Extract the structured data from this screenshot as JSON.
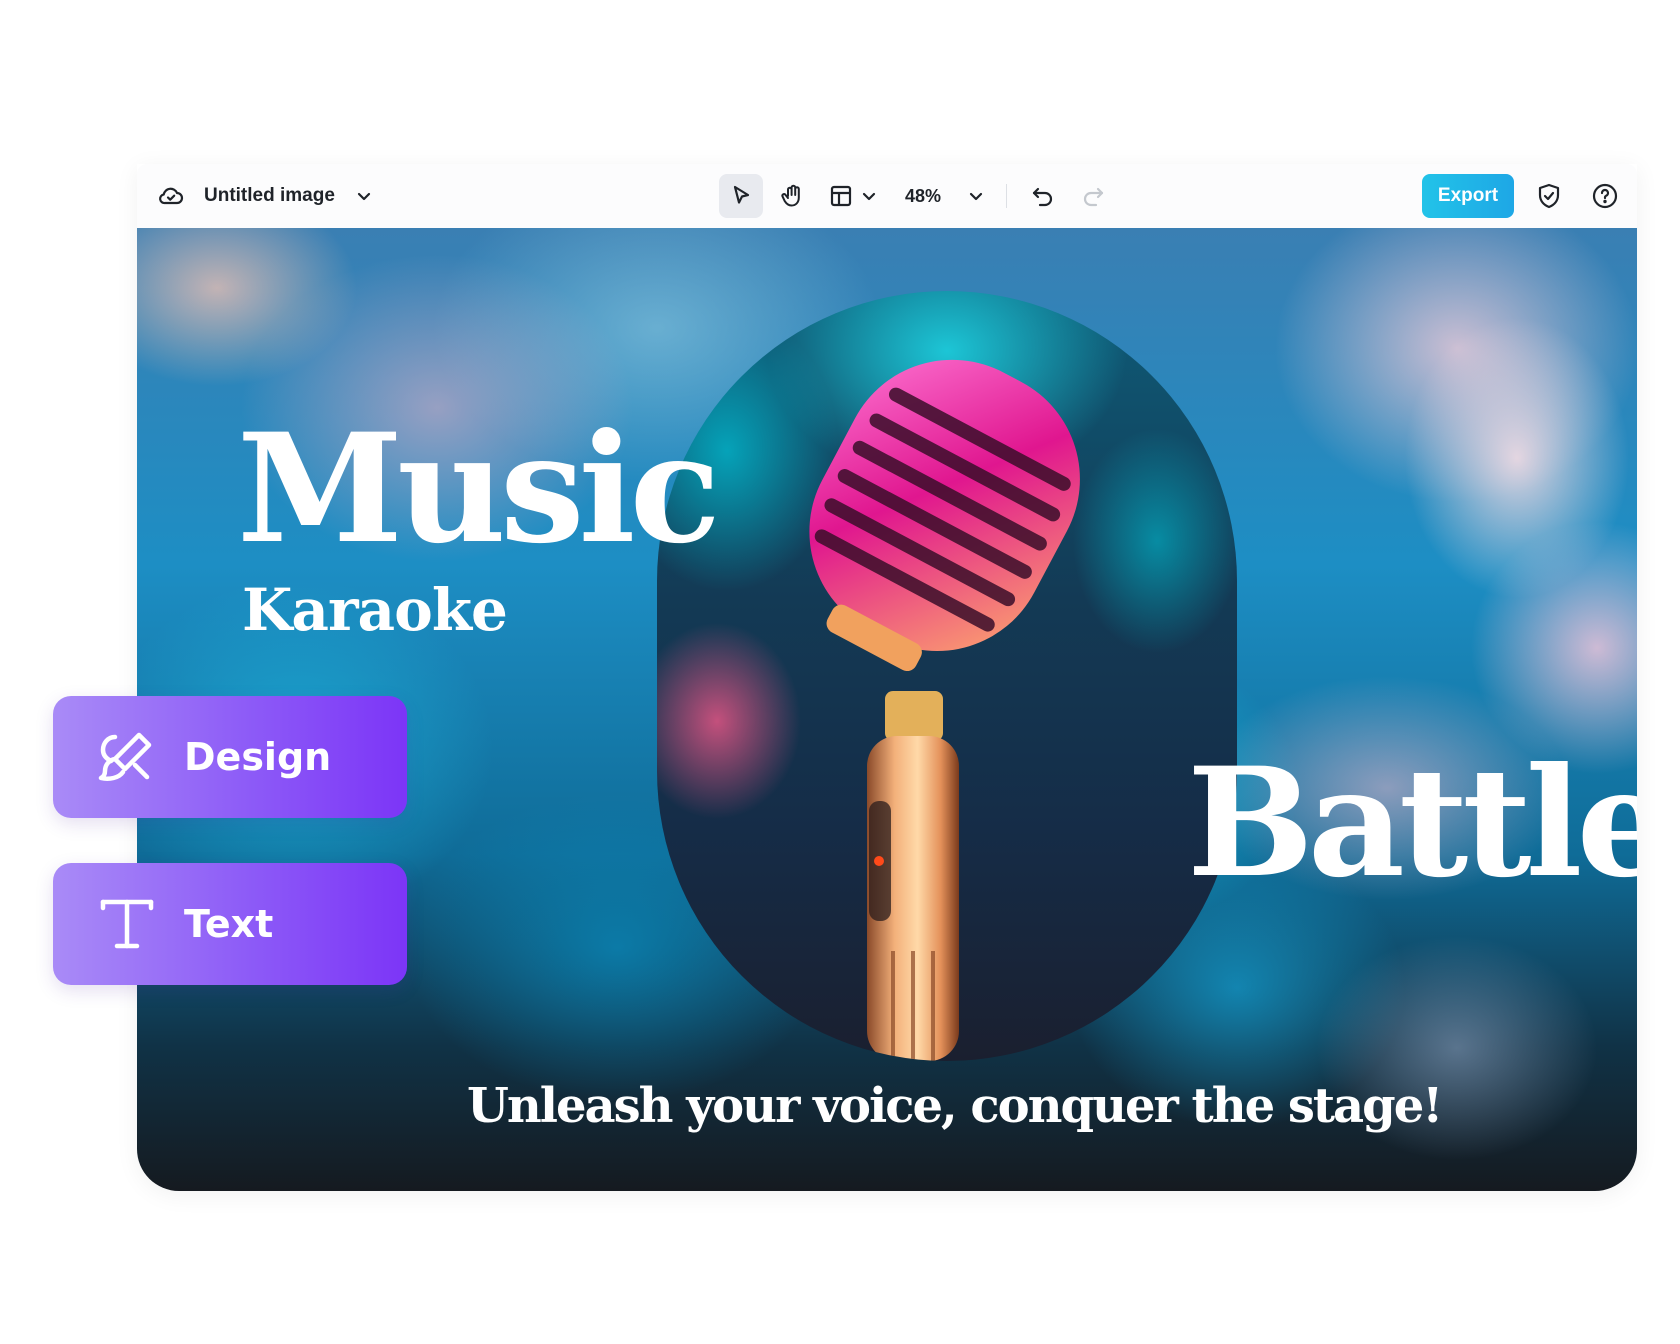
{
  "toolbar": {
    "doc_title": "Untitled image",
    "zoom": "48%",
    "export_label": "Export",
    "icons": [
      "cloud-icon",
      "chevron-down-icon",
      "select-pointer-icon",
      "hand-pan-icon",
      "layout-icon",
      "chevron-down-icon",
      "chevron-down-icon",
      "undo-icon",
      "redo-icon",
      "shield-check-icon",
      "help-icon"
    ]
  },
  "canvas": {
    "title": "Music",
    "subtitle": "Karaoke",
    "title2": "Battle",
    "tagline": "Unleash your voice, conquer the stage!"
  },
  "side_panel": {
    "items": [
      {
        "label": "Design",
        "icon": "brush-icon"
      },
      {
        "label": "Text",
        "icon": "text-icon"
      }
    ]
  },
  "colors": {
    "export": "#1fb6e8",
    "chip_start": "#a98bf7",
    "chip_end": "#7c35f7"
  }
}
